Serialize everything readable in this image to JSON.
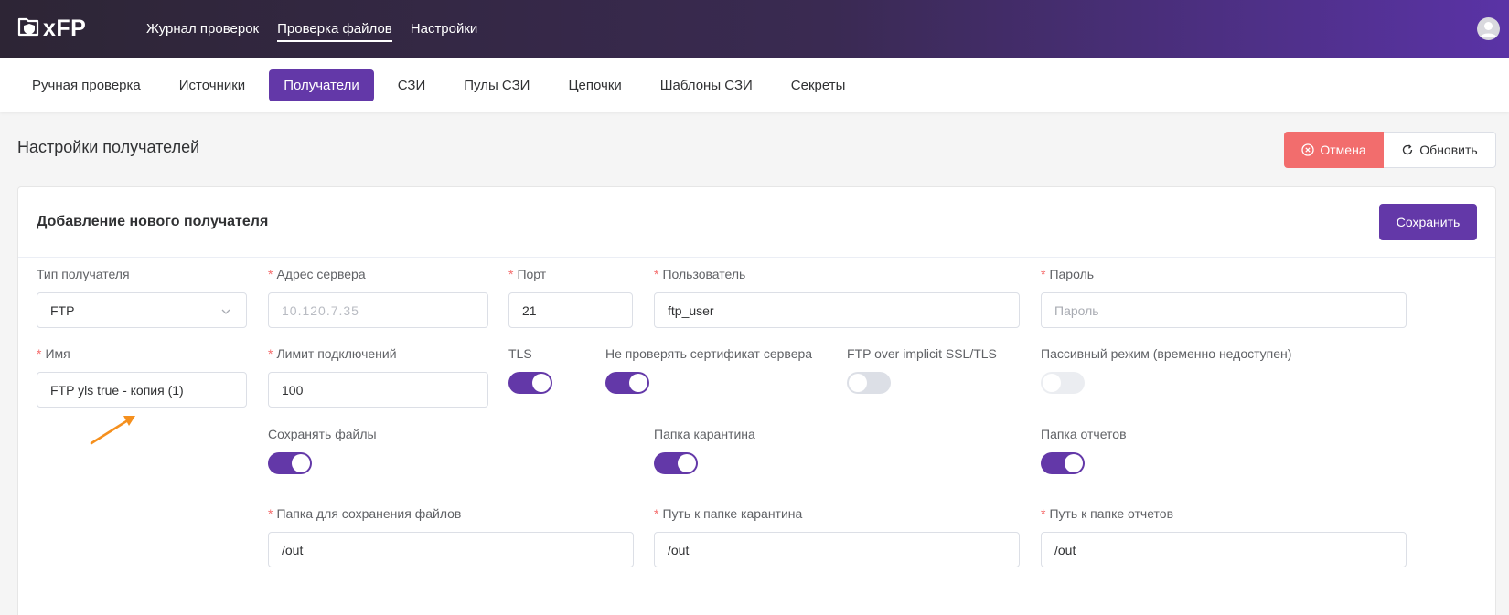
{
  "app": {
    "logo_text": "xFP"
  },
  "topnav": [
    {
      "label": "Журнал проверок",
      "active": false
    },
    {
      "label": "Проверка файлов",
      "active": true
    },
    {
      "label": "Настройки",
      "active": false
    }
  ],
  "subnav": [
    {
      "label": "Ручная проверка",
      "active": false
    },
    {
      "label": "Источники",
      "active": false
    },
    {
      "label": "Получатели",
      "active": true
    },
    {
      "label": "СЗИ",
      "active": false
    },
    {
      "label": "Пулы СЗИ",
      "active": false
    },
    {
      "label": "Цепочки",
      "active": false
    },
    {
      "label": "Шаблоны СЗИ",
      "active": false
    },
    {
      "label": "Секреты",
      "active": false
    }
  ],
  "page": {
    "title": "Настройки получателей",
    "cancel_label": "Отмена",
    "refresh_label": "Обновить"
  },
  "card": {
    "title": "Добавление нового получателя",
    "save_label": "Сохранить"
  },
  "form": {
    "type": {
      "label": "Тип получателя",
      "value": "FTP"
    },
    "server": {
      "label": "Адрес сервера",
      "value": "10.120.7.35",
      "required": true
    },
    "port": {
      "label": "Порт",
      "value": "21",
      "required": true
    },
    "user": {
      "label": "Пользователь",
      "value": "ftp_user",
      "required": true
    },
    "password": {
      "label": "Пароль",
      "placeholder": "Пароль",
      "required": true
    },
    "name": {
      "label": "Имя",
      "value": "FTP yls true - копия (1)",
      "required": true
    },
    "limit": {
      "label": "Лимит подключений",
      "value": "100",
      "required": true
    },
    "tls": {
      "label": "TLS",
      "on": true
    },
    "nocert": {
      "label": "Не проверять сертификат сервера",
      "on": true
    },
    "implicit": {
      "label": "FTP over implicit SSL/TLS",
      "on": false
    },
    "passive": {
      "label": "Пассивный режим (временно недоступен)",
      "on": false,
      "disabled": true
    },
    "save_files": {
      "label": "Сохранять файлы",
      "on": true
    },
    "quarantine": {
      "label": "Папка карантина",
      "on": true
    },
    "reports": {
      "label": "Папка отчетов",
      "on": true
    },
    "save_path": {
      "label": "Папка для сохранения файлов",
      "value": "/out",
      "required": true
    },
    "quarantine_path": {
      "label": "Путь к папке карантина",
      "value": "/out",
      "required": true
    },
    "reports_path": {
      "label": "Путь к папке отчетов",
      "value": "/out",
      "required": true
    }
  },
  "colors": {
    "accent": "#6338a8",
    "cancel": "#f26d6d",
    "required": "#f56c6c",
    "annotation_arrow": "#f5901e"
  },
  "icons": {
    "logo": "folder-shield-icon",
    "avatar": "user-avatar-icon",
    "cancel": "close-circle-icon",
    "refresh": "refresh-icon",
    "select": "chevron-down-icon",
    "annotation": "orange-arrow-icon"
  }
}
